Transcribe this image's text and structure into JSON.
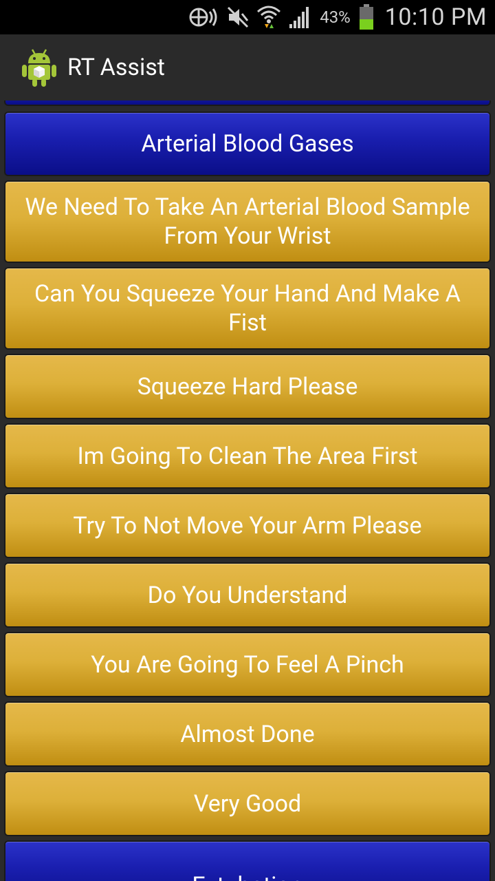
{
  "status_bar": {
    "battery_percent": "43%",
    "time": "10:10 PM",
    "icons": [
      "data-sync-icon",
      "mute-icon",
      "wifi-icon",
      "signal-icon",
      "battery-icon"
    ]
  },
  "action_bar": {
    "title": "RT Assist",
    "icon": "android-app-icon"
  },
  "sections": [
    {
      "label": "Arterial Blood Gases",
      "style": "blue"
    },
    {
      "label": "We Need To Take An Arterial Blood Sample From Your Wrist",
      "style": "gold"
    },
    {
      "label": "Can You Squeeze Your Hand And Make A Fist",
      "style": "gold"
    },
    {
      "label": "Squeeze Hard Please",
      "style": "gold"
    },
    {
      "label": "Im Going To Clean The Area First",
      "style": "gold"
    },
    {
      "label": "Try To Not Move Your Arm Please",
      "style": "gold"
    },
    {
      "label": "Do You Understand",
      "style": "gold"
    },
    {
      "label": "You Are Going To Feel A Pinch",
      "style": "gold"
    },
    {
      "label": "Almost  Done",
      "style": "gold"
    },
    {
      "label": "Very Good",
      "style": "gold"
    },
    {
      "label": "Extubation",
      "style": "blue"
    }
  ],
  "colors": {
    "blue_header": "#1a1fb0",
    "gold_button": "#d9a92c"
  }
}
